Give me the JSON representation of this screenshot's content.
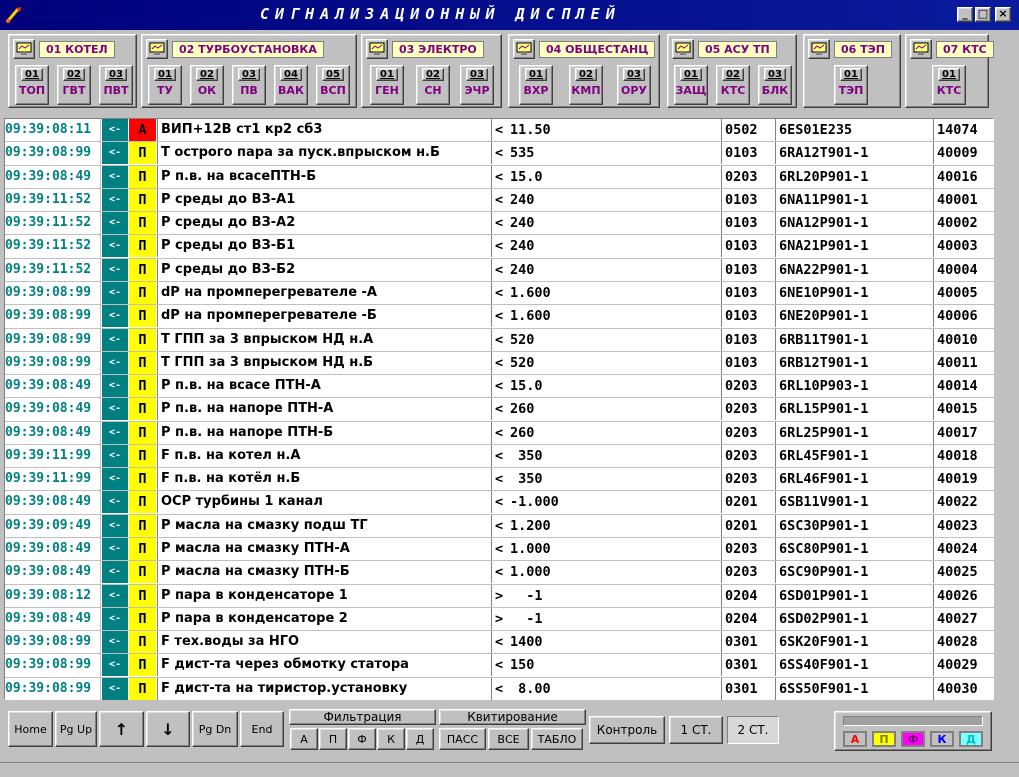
{
  "window": {
    "title": "СИГНАЛИЗАЦИОННЫЙ  ДИСПЛЕЙ",
    "min_label": "_",
    "max_label": "□",
    "close_label": "×"
  },
  "groups": [
    {
      "label": "01 КОТЕЛ",
      "subs": [
        {
          "n": "01",
          "l": "ТОП"
        },
        {
          "n": "02",
          "l": "ГВТ"
        },
        {
          "n": "03",
          "l": "ПВТ"
        }
      ]
    },
    {
      "label": "02 ТУРБОУСТАНОВКА",
      "subs": [
        {
          "n": "01",
          "l": "ТУ"
        },
        {
          "n": "02",
          "l": "ОК"
        },
        {
          "n": "03",
          "l": "ПВ"
        },
        {
          "n": "04",
          "l": "ВАК"
        },
        {
          "n": "05",
          "l": "ВСП"
        }
      ]
    },
    {
      "label": "03 ЭЛЕКТРО",
      "subs": [
        {
          "n": "01",
          "l": "ГЕН"
        },
        {
          "n": "02",
          "l": "СН"
        },
        {
          "n": "03",
          "l": "ЭЧР"
        }
      ]
    },
    {
      "label": "04 ОБЩЕСТАНЦ",
      "subs": [
        {
          "n": "01",
          "l": "ВХР"
        },
        {
          "n": "02",
          "l": "КМП"
        },
        {
          "n": "03",
          "l": "ОРУ"
        }
      ]
    },
    {
      "label": "05 АСУ ТП",
      "subs": [
        {
          "n": "01",
          "l": "ЗАЩ"
        },
        {
          "n": "02",
          "l": "КТС"
        },
        {
          "n": "03",
          "l": "БЛК"
        }
      ]
    },
    {
      "label": "06 ТЭП",
      "subs": [
        {
          "n": "01",
          "l": "ТЭП"
        }
      ]
    },
    {
      "label": "07 КТС",
      "subs": [
        {
          "n": "01",
          "l": "КТС"
        }
      ]
    }
  ],
  "rows": [
    {
      "time": "09:39:08:11",
      "arrow": "<-",
      "type": "А",
      "desc": "ВИП+12В ст1 кр2 сб3",
      "cmp": "<",
      "val": "11.50",
      "code": "0502",
      "kks": "6ES01E235",
      "num": "14074"
    },
    {
      "time": "09:39:08:99",
      "arrow": "<-",
      "type": "П",
      "desc": "Т острого пара за пуск.впрыском н.Б",
      "cmp": "<",
      "val": "535",
      "code": "0103",
      "kks": "6RA12T901-1",
      "num": "40009"
    },
    {
      "time": "09:39:08:49",
      "arrow": "<-",
      "type": "П",
      "desc": "Р п.в. на всасеПТН-Б",
      "cmp": "<",
      "val": "15.0",
      "code": "0203",
      "kks": "6RL20P901-1",
      "num": "40016"
    },
    {
      "time": "09:39:11:52",
      "arrow": "<-",
      "type": "П",
      "desc": "Р среды до ВЗ-А1",
      "cmp": "<",
      "val": "240",
      "code": "0103",
      "kks": "6NA11P901-1",
      "num": "40001"
    },
    {
      "time": "09:39:11:52",
      "arrow": "<-",
      "type": "П",
      "desc": "Р среды до ВЗ-А2",
      "cmp": "<",
      "val": "240",
      "code": "0103",
      "kks": "6NA12P901-1",
      "num": "40002"
    },
    {
      "time": "09:39:11:52",
      "arrow": "<-",
      "type": "П",
      "desc": "Р среды до ВЗ-Б1",
      "cmp": "<",
      "val": "240",
      "code": "0103",
      "kks": "6NA21P901-1",
      "num": "40003"
    },
    {
      "time": "09:39:11:52",
      "arrow": "<-",
      "type": "П",
      "desc": "Р среды до ВЗ-Б2",
      "cmp": "<",
      "val": "240",
      "code": "0103",
      "kks": "6NA22P901-1",
      "num": "40004"
    },
    {
      "time": "09:39:08:99",
      "arrow": "<-",
      "type": "П",
      "desc": "dР на промперегревателе -А",
      "cmp": "<",
      "val": "1.600",
      "code": "0103",
      "kks": "6NE10P901-1",
      "num": "40005"
    },
    {
      "time": "09:39:08:99",
      "arrow": "<-",
      "type": "П",
      "desc": "dР на промперегревателе -Б",
      "cmp": "<",
      "val": "1.600",
      "code": "0103",
      "kks": "6NE20P901-1",
      "num": "40006"
    },
    {
      "time": "09:39:08:99",
      "arrow": "<-",
      "type": "П",
      "desc": "Т ГПП за 3 впрыском НД н.А",
      "cmp": "<",
      "val": "520",
      "code": "0103",
      "kks": "6RB11T901-1",
      "num": "40010"
    },
    {
      "time": "09:39:08:99",
      "arrow": "<-",
      "type": "П",
      "desc": "Т ГПП за 3 впрыском НД н.Б",
      "cmp": "<",
      "val": "520",
      "code": "0103",
      "kks": "6RB12T901-1",
      "num": "40011"
    },
    {
      "time": "09:39:08:49",
      "arrow": "<-",
      "type": "П",
      "desc": "Р п.в. на всасе ПТН-А",
      "cmp": "<",
      "val": "15.0",
      "code": "0203",
      "kks": "6RL10P903-1",
      "num": "40014"
    },
    {
      "time": "09:39:08:49",
      "arrow": "<-",
      "type": "П",
      "desc": "Р п.в. на напоре ПТН-А",
      "cmp": "<",
      "val": "260",
      "code": "0203",
      "kks": "6RL15P901-1",
      "num": "40015"
    },
    {
      "time": "09:39:08:49",
      "arrow": "<-",
      "type": "П",
      "desc": "Р п.в. на напоре  ПТН-Б",
      "cmp": "<",
      "val": "260",
      "code": "0203",
      "kks": "6RL25P901-1",
      "num": "40017"
    },
    {
      "time": "09:39:11:99",
      "arrow": "<-",
      "type": "П",
      "desc": "F п.в. на котел н.А",
      "cmp": "<",
      "val": " 350",
      "code": "0203",
      "kks": "6RL45F901-1",
      "num": "40018"
    },
    {
      "time": "09:39:11:99",
      "arrow": "<-",
      "type": "П",
      "desc": "F п.в. на котёл н.Б",
      "cmp": "<",
      "val": " 350",
      "code": "0203",
      "kks": "6RL46F901-1",
      "num": "40019"
    },
    {
      "time": "09:39:08:49",
      "arrow": "<-",
      "type": "П",
      "desc": "ОСР турбины 1 канал",
      "cmp": "<",
      "val": "-1.000",
      "code": "0201",
      "kks": "6SB11V901-1",
      "num": "40022"
    },
    {
      "time": "09:39:09:49",
      "arrow": "<-",
      "type": "П",
      "desc": "Р масла на смазку подш ТГ",
      "cmp": "<",
      "val": "1.200",
      "code": "0201",
      "kks": "6SC30P901-1",
      "num": "40023"
    },
    {
      "time": "09:39:08:49",
      "arrow": "<-",
      "type": "П",
      "desc": "Р масла на смазку ПТН-А",
      "cmp": "<",
      "val": "1.000",
      "code": "0203",
      "kks": "6SC80P901-1",
      "num": "40024"
    },
    {
      "time": "09:39:08:49",
      "arrow": "<-",
      "type": "П",
      "desc": "Р масла на смазку ПТН-Б",
      "cmp": "<",
      "val": "1.000",
      "code": "0203",
      "kks": "6SC90P901-1",
      "num": "40025"
    },
    {
      "time": "09:39:08:12",
      "arrow": "<-",
      "type": "П",
      "desc": "Р пара в конденсаторе 1",
      "cmp": ">",
      "val": "  -1",
      "code": "0204",
      "kks": "6SD01P901-1",
      "num": "40026"
    },
    {
      "time": "09:39:08:49",
      "arrow": "<-",
      "type": "П",
      "desc": "Р пара в конденсаторе 2",
      "cmp": ">",
      "val": "  -1",
      "code": "0204",
      "kks": "6SD02P901-1",
      "num": "40027"
    },
    {
      "time": "09:39:08:99",
      "arrow": "<-",
      "type": "П",
      "desc": "F тех.воды за НГО",
      "cmp": "<",
      "val": "1400",
      "code": "0301",
      "kks": "6SK20F901-1",
      "num": "40028"
    },
    {
      "time": "09:39:08:99",
      "arrow": "<-",
      "type": "П",
      "desc": "F дист-та через обмотку статора",
      "cmp": "<",
      "val": "150",
      "code": "0301",
      "kks": "6SS40F901-1",
      "num": "40029"
    },
    {
      "time": "09:39:08:99",
      "arrow": "<-",
      "type": "П",
      "desc": "F дист-та на тиристор.установку",
      "cmp": "<",
      "val": " 8.00",
      "code": "0301",
      "kks": "6SS50F901-1",
      "num": "40030"
    }
  ],
  "colors": {
    "type_A": "#ff0000",
    "type_P": "#ffff00",
    "time": "#008080",
    "label_purple": "#800080"
  },
  "nav": {
    "home": "Home",
    "pgup": "Pg Up",
    "up": "↑",
    "down": "↓",
    "pgdn": "Pg Dn",
    "end": "End"
  },
  "filter": {
    "label": "Фильтрация",
    "buttons": [
      "А",
      "П",
      "Ф",
      "К",
      "Д"
    ]
  },
  "ack": {
    "label": "Квитирование",
    "buttons": [
      "ПАСС",
      "ВСЕ",
      "ТАБЛО"
    ]
  },
  "modes": {
    "control": "Контроль",
    "st1": "1 СТ.",
    "st2": "2 СТ."
  },
  "legend": [
    {
      "label": "А",
      "color": "#ff0000"
    },
    {
      "label": "П",
      "color": "#ffff00"
    },
    {
      "label": "Ф",
      "color": "#ff00ff"
    },
    {
      "label": "К",
      "color": "#0000ff"
    },
    {
      "label": "Д",
      "color": "#00c0c0"
    }
  ]
}
